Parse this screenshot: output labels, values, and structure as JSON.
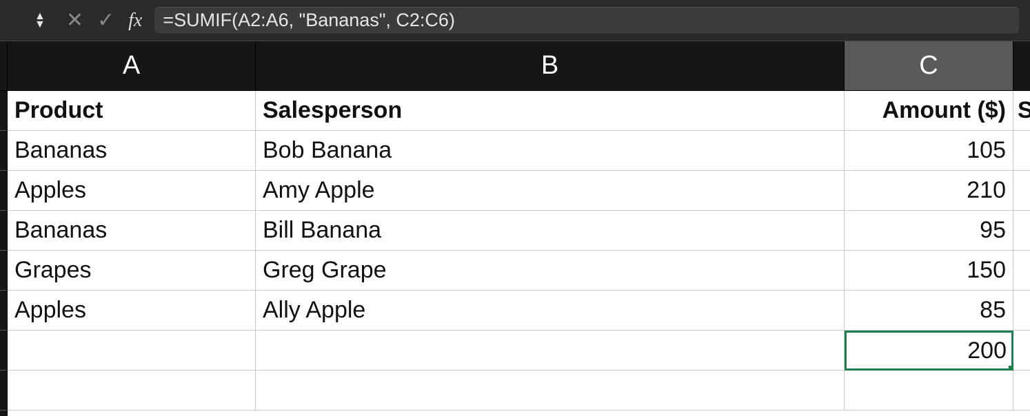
{
  "formula_bar": {
    "fx_label": "fx",
    "formula": "=SUMIF(A2:A6, \"Bananas\", C2:C6)"
  },
  "columns": {
    "A": "A",
    "B": "B",
    "C": "C",
    "D_fragment": "S"
  },
  "headers": {
    "product": "Product",
    "salesperson": "Salesperson",
    "amount": "Amount ($)"
  },
  "rows": [
    {
      "product": "Bananas",
      "salesperson": "Bob Banana",
      "amount": "105"
    },
    {
      "product": "Apples",
      "salesperson": "Amy Apple",
      "amount": "210"
    },
    {
      "product": "Bananas",
      "salesperson": "Bill Banana",
      "amount": "95"
    },
    {
      "product": "Grapes",
      "salesperson": "Greg Grape",
      "amount": "150"
    },
    {
      "product": "Apples",
      "salesperson": "Ally Apple",
      "amount": "85"
    }
  ],
  "result_cell": "200"
}
